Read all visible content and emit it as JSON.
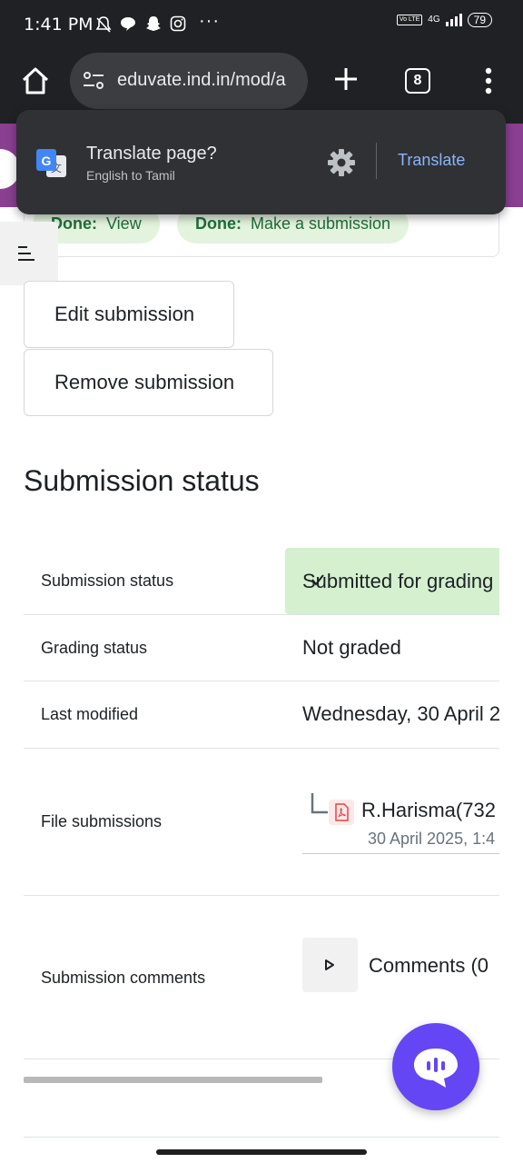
{
  "status_bar": {
    "time": "1:41 PM",
    "icons": [
      "mute-icon",
      "chat-bubble-icon",
      "snapchat-icon",
      "instagram-icon"
    ],
    "more": "···",
    "volte": "Vo LTE",
    "network": "4G",
    "battery": "79"
  },
  "browser": {
    "url": "eduvate.ind.in/mod/a",
    "tab_count": "8"
  },
  "translate_popup": {
    "title": "Translate page?",
    "subtitle": "English to Tamil",
    "button": "Translate"
  },
  "completion": [
    {
      "status": "Done:",
      "label": "View"
    },
    {
      "status": "Done:",
      "label": "Make a submission"
    }
  ],
  "actions": {
    "edit": "Edit submission",
    "remove": "Remove submission"
  },
  "section_title": "Submission status",
  "table": {
    "submission_status": {
      "label": "Submission status",
      "value": "Submitted for grading"
    },
    "grading_status": {
      "label": "Grading status",
      "value": "Not graded"
    },
    "last_modified": {
      "label": "Last modified",
      "value": "Wednesday, 30 April 2"
    },
    "file_submissions": {
      "label": "File submissions",
      "file_name": "R.Harisma(732",
      "file_date": "30 April 2025, 1:4"
    },
    "submission_comments": {
      "label": "Submission comments",
      "value": "Comments (0"
    }
  },
  "colors": {
    "status_bar": "#202124",
    "header_purple": "#8a3f91",
    "submitted_bg": "#d4f0cf",
    "fab": "#6546f5",
    "translate_link": "#8ab4f8"
  }
}
